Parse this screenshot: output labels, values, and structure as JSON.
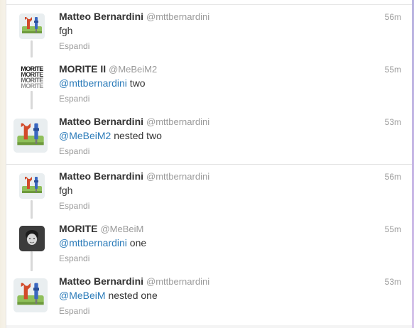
{
  "conversations": [
    {
      "tweets": [
        {
          "name": "Matteo Bernardini",
          "handle": "@mttbernardini",
          "time": "56m",
          "mention": "",
          "text": "fgh",
          "expand": "Espandi",
          "avatar": "tools-icon"
        },
        {
          "name": "MORITE II",
          "handle": "@MeBeiM2",
          "time": "55m",
          "mention": "@mttbernardini",
          "text": " two",
          "expand": "Espandi",
          "avatar": "morite-text-logo",
          "logo_lines": [
            "MORITE",
            "MORITE",
            "MORITE",
            "MORITE"
          ]
        },
        {
          "name": "Matteo Bernardini",
          "handle": "@mttbernardini",
          "time": "53m",
          "mention": "@MeBeiM2",
          "text": " nested two",
          "expand": "Espandi",
          "avatar": "tools-icon"
        }
      ]
    },
    {
      "tweets": [
        {
          "name": "Matteo Bernardini",
          "handle": "@mttbernardini",
          "time": "56m",
          "mention": "",
          "text": "fgh",
          "expand": "Espandi",
          "avatar": "tools-icon"
        },
        {
          "name": "MORITE",
          "handle": "@MeBeiM",
          "time": "55m",
          "mention": "@mttbernardini",
          "text": " one",
          "expand": "Espandi",
          "avatar": "portrait-photo"
        },
        {
          "name": "Matteo Bernardini",
          "handle": "@mttbernardini",
          "time": "53m",
          "mention": "@MeBeiM",
          "text": " nested one",
          "expand": "Espandi",
          "avatar": "tools-icon"
        }
      ]
    }
  ]
}
